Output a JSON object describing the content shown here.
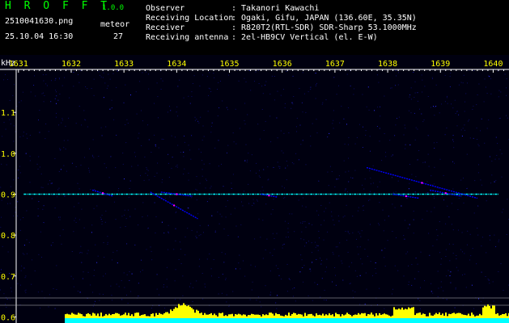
{
  "app": {
    "title": "H R O F F T",
    "version": "1.0.0",
    "file_name": "2510041630.png",
    "timestamp": "25.10.04 16:30",
    "meteor_label": "meteor",
    "meteor_count": "27"
  },
  "info": [
    {
      "key": "Observer",
      "value": ": Takanori Kawachi"
    },
    {
      "key": "Receiving Location",
      "value": ": Ogaki, Gifu, JAPAN (136.60E, 35.35N)"
    },
    {
      "key": "Receiver",
      "value": ": R820T2(RTL-SDR) SDR-Sharp 53.1000MHz"
    },
    {
      "key": "Receiving antenna",
      "value": ": 2el-HB9CV Vertical (el. E-W)"
    }
  ],
  "chart_data": {
    "type": "heatmap",
    "ylabel": "kHz",
    "x_ticks": [
      "1631",
      "1632",
      "1633",
      "1634",
      "1635",
      "1636",
      "1637",
      "1638",
      "1639",
      "1640"
    ],
    "x_range": [
      1630.65,
      1640.3
    ],
    "y_ticks": [
      "1.1",
      "1.0",
      "0.9",
      "0.8",
      "0.7",
      "0.6"
    ],
    "y_range": [
      0.585,
      1.205
    ],
    "baseline_khz": 0.9,
    "echoes": [
      {
        "t0": 1631.1,
        "f0": 0.9,
        "t1": 1640.1,
        "f1": 0.9
      },
      {
        "t0": 1632.4,
        "f0": 0.91,
        "t1": 1632.8,
        "f1": 0.895
      },
      {
        "t0": 1633.5,
        "f0": 0.905,
        "t1": 1634.4,
        "f1": 0.84
      },
      {
        "t0": 1633.7,
        "f0": 0.905,
        "t1": 1634.3,
        "f1": 0.895
      },
      {
        "t0": 1635.6,
        "f0": 0.9,
        "t1": 1635.9,
        "f1": 0.893
      },
      {
        "t0": 1637.6,
        "f0": 0.965,
        "t1": 1639.7,
        "f1": 0.89
      },
      {
        "t0": 1638.1,
        "f0": 0.9,
        "t1": 1638.6,
        "f1": 0.89
      },
      {
        "t0": 1638.8,
        "f0": 0.91,
        "t1": 1639.4,
        "f1": 0.895
      }
    ],
    "colors": {
      "axis": "#ffffff",
      "tick_text": "#ffff00",
      "label_text": "#ffffff",
      "hot": "#ff00ff",
      "warm": "#00ffff",
      "cool": "#0000ff",
      "activity": "#ffff00",
      "activity_base": "#00ffff"
    }
  }
}
